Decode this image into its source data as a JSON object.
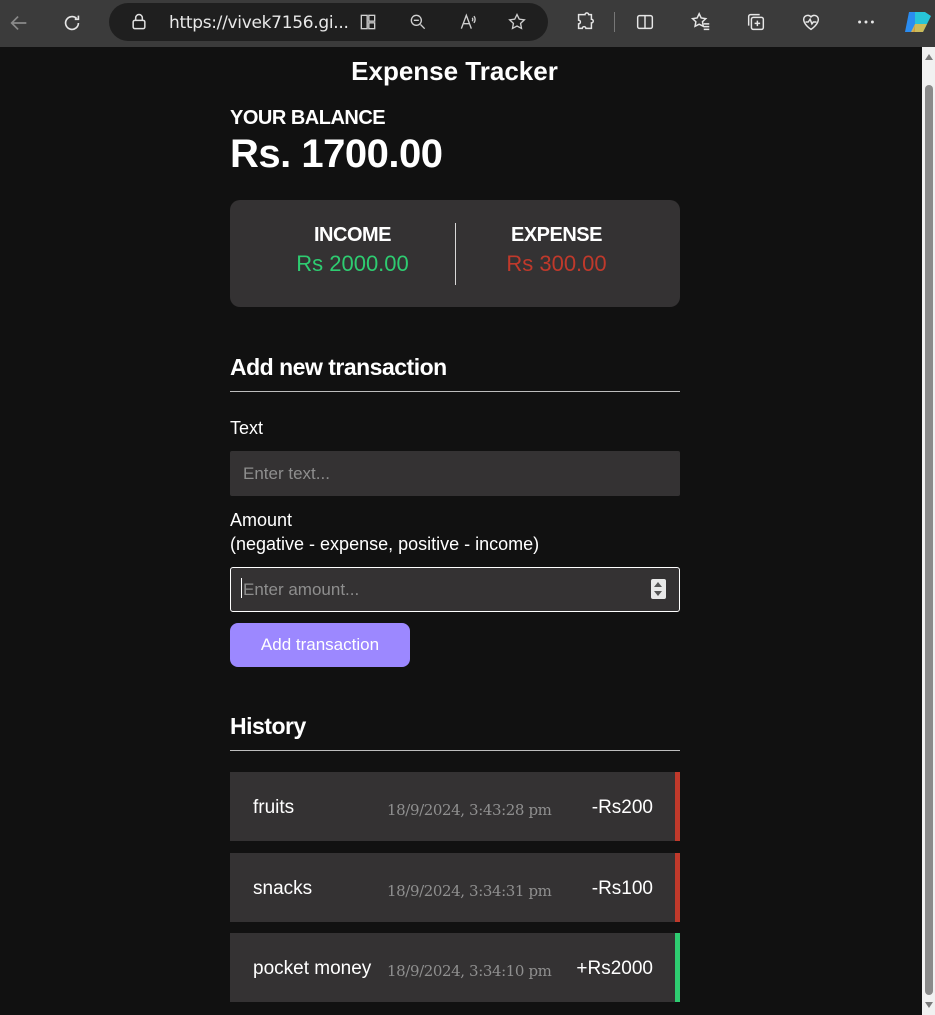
{
  "browser": {
    "url": "https://vivek7156.gi..."
  },
  "app": {
    "title": "Expense Tracker",
    "balance_label": "YOUR BALANCE",
    "balance_value": "Rs. 1700.00",
    "income_label": "INCOME",
    "income_value": "Rs 2000.00",
    "expense_label": "EXPENSE",
    "expense_value": "Rs 300.00",
    "colors": {
      "income": "#2ecc71",
      "expense": "#c0392b",
      "button": "#9c88ff"
    }
  },
  "form": {
    "heading": "Add new transaction",
    "text_label": "Text",
    "text_placeholder": "Enter text...",
    "amount_label": "Amount",
    "amount_hint": "(negative - expense, positive - income)",
    "amount_placeholder": "Enter amount...",
    "submit_label": "Add transaction"
  },
  "history": {
    "heading": "History",
    "items": [
      {
        "name": "fruits",
        "date": "18/9/2024, 3:43:28 pm",
        "amount": "-Rs200",
        "type": "expense"
      },
      {
        "name": "snacks",
        "date": "18/9/2024, 3:34:31 pm",
        "amount": "-Rs100",
        "type": "expense"
      },
      {
        "name": "pocket money",
        "date": "18/9/2024, 3:34:10 pm",
        "amount": "+Rs2000",
        "type": "income"
      }
    ]
  }
}
